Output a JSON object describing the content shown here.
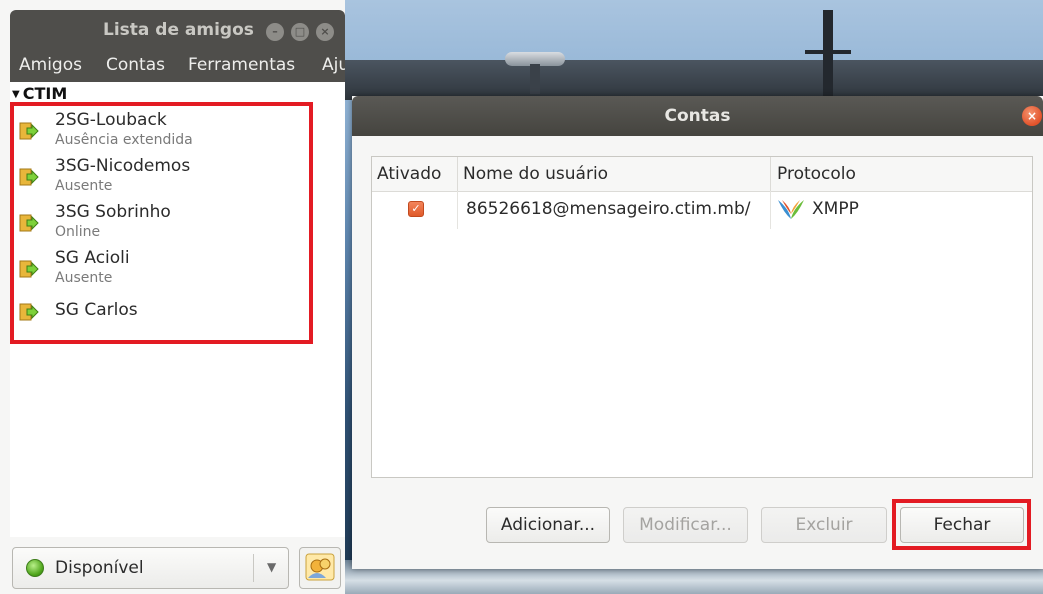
{
  "buddy_window": {
    "title": "Lista de amigos",
    "menu": [
      "Amigos",
      "Contas",
      "Ferramentas",
      "Ajuda"
    ],
    "group": "CTIM",
    "buddies": [
      {
        "name": "2SG-Louback",
        "status": "Ausência extendida"
      },
      {
        "name": "3SG-Nicodemos",
        "status": "Ausente"
      },
      {
        "name": "3SG Sobrinho",
        "status": "Online"
      },
      {
        "name": "SG Acioli",
        "status": "Ausente"
      },
      {
        "name": "SG Carlos",
        "status": ""
      }
    ],
    "status_selector": {
      "value": "Disponível",
      "color": "#4fa51b"
    }
  },
  "accounts_dialog": {
    "title": "Contas",
    "columns": [
      "Ativado",
      "Nome do usuário",
      "Protocolo"
    ],
    "rows": [
      {
        "enabled": true,
        "username": "86526618@mensageiro.ctim.mb/",
        "protocol": "XMPP",
        "protocol_icon": "xmpp-icon"
      }
    ],
    "buttons": {
      "add": "Adicionar...",
      "modify": "Modificar...",
      "delete": "Excluir",
      "close": "Fechar"
    }
  },
  "colors": {
    "highlight": "#e31b23",
    "titlebar": "#4f4e4b",
    "checkbox": "#e05a2a"
  }
}
